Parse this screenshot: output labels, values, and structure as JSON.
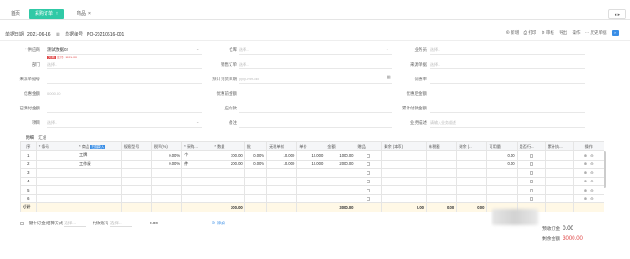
{
  "tabs": {
    "home": "首页",
    "active": "采购订单",
    "active_close": "×",
    "other": "商品",
    "other_close": "×",
    "nav": "◂ ▸"
  },
  "toolbar": {
    "date_label": "单据日期",
    "date_value": "2021-06-16",
    "doc_no_label": "单据编号",
    "doc_no_value": "PO-20210616-001",
    "actions": [
      "⊕ 新增",
      "⎙ 打印",
      "⚙ 审核",
      "导出",
      "操作",
      "⋯ 历史单据"
    ],
    "more": "▸"
  },
  "form": {
    "supplier_label": "* 供应商",
    "supplier_value": "测试数据02",
    "supplier_badge": "欠款",
    "supplier_debt": "应付: 1901.00",
    "dept_label": "部门",
    "dept_ph": "选择...",
    "source_label": "来源单据号",
    "warehouse_label": "仓库",
    "warehouse_ph": "选择...",
    "salesorder_label": "销售订单",
    "salesorder_ph": "选择...",
    "plan_date_label": "预计到货日期",
    "plan_date_ph": "yyyy-mm-dd",
    "salesman_label": "业务员",
    "salesman_ph": "选择...",
    "source_type_label": "来源单据",
    "source_type_ph": "选择...",
    "optimize_amount_label": "优惠率",
    "optimize_before_label": "优惠前金额",
    "optimize_after_label": "优惠后金额",
    "discount_label": "优惠金额",
    "discount_ph": "0000.00",
    "deposit_label": "已预付金额",
    "prepay_label": "应付款",
    "total_paid_label": "累计付款金额",
    "project_label": "项目",
    "project_ph": "选择...",
    "remark_label": "备注",
    "attach_label": "业务描述",
    "attach_ph": "请输入业务描述"
  },
  "subtabs": [
    "明细",
    "汇总"
  ],
  "table": {
    "headers": [
      "序",
      "* 条码",
      "* 商品",
      "规格型号",
      "税率(%)",
      "* 采购...",
      "* 数量",
      "批",
      "无税单价",
      "单价",
      "金额",
      "赠品",
      "剩余 (本币)",
      "未税额",
      "剩余 (...",
      "可用量",
      "是否行...",
      "累计执...",
      "操作"
    ],
    "add_chip": "扫描录入",
    "rows": [
      {
        "idx": "1",
        "code": "",
        "name": "工牌",
        "spec": "",
        "tax": "0.00%",
        "unit": "个",
        "qty": "100.00",
        "batch": "0.00%",
        "nprice": "10.000",
        "price": "10.000",
        "amount": "1000.00",
        "avail": "0.00"
      },
      {
        "idx": "2",
        "code": "",
        "name": "工作服",
        "spec": "",
        "tax": "0.00%",
        "unit": "件",
        "qty": "200.00",
        "batch": "0.00%",
        "nprice": "10.000",
        "price": "10.000",
        "amount": "2000.00",
        "avail": "0.00"
      },
      {
        "idx": "3",
        "code": "",
        "name": "",
        "spec": "",
        "tax": "",
        "unit": "",
        "qty": "",
        "batch": "",
        "nprice": "",
        "price": "",
        "amount": "",
        "avail": ""
      },
      {
        "idx": "4",
        "code": "",
        "name": "",
        "spec": "",
        "tax": "",
        "unit": "",
        "qty": "",
        "batch": "",
        "nprice": "",
        "price": "",
        "amount": "",
        "avail": ""
      },
      {
        "idx": "5",
        "code": "",
        "name": "",
        "spec": "",
        "tax": "",
        "unit": "",
        "qty": "",
        "batch": "",
        "nprice": "",
        "price": "",
        "amount": "",
        "avail": ""
      },
      {
        "idx": "6",
        "code": "",
        "name": "",
        "spec": "",
        "tax": "",
        "unit": "",
        "qty": "",
        "batch": "",
        "nprice": "",
        "price": "",
        "amount": "",
        "avail": ""
      }
    ],
    "sum_label": "小计",
    "sum_qty": "300.00",
    "sum_amount": "3000.00",
    "sum_r1": "0.00",
    "sum_r2": "0.00",
    "sum_r3": "0.00",
    "op_icons": [
      "⊕",
      "⊖"
    ]
  },
  "footer": {
    "checkbox_label": "一键付订金",
    "pay_method_label": "结算方式",
    "pay_method_ph": "选择...",
    "pay_no_label": "付款账号",
    "pay_no_ph": "选择...",
    "amount": "0.00",
    "add_link": "⊕ 添加",
    "prepaid_label": "预收订金",
    "prepaid_value": "0.00",
    "total_label": "剩余金额",
    "total_value": "3000.00"
  },
  "colors": {
    "accent": "#30c9a6",
    "link": "#3a8ee6",
    "danger": "#e04848"
  }
}
